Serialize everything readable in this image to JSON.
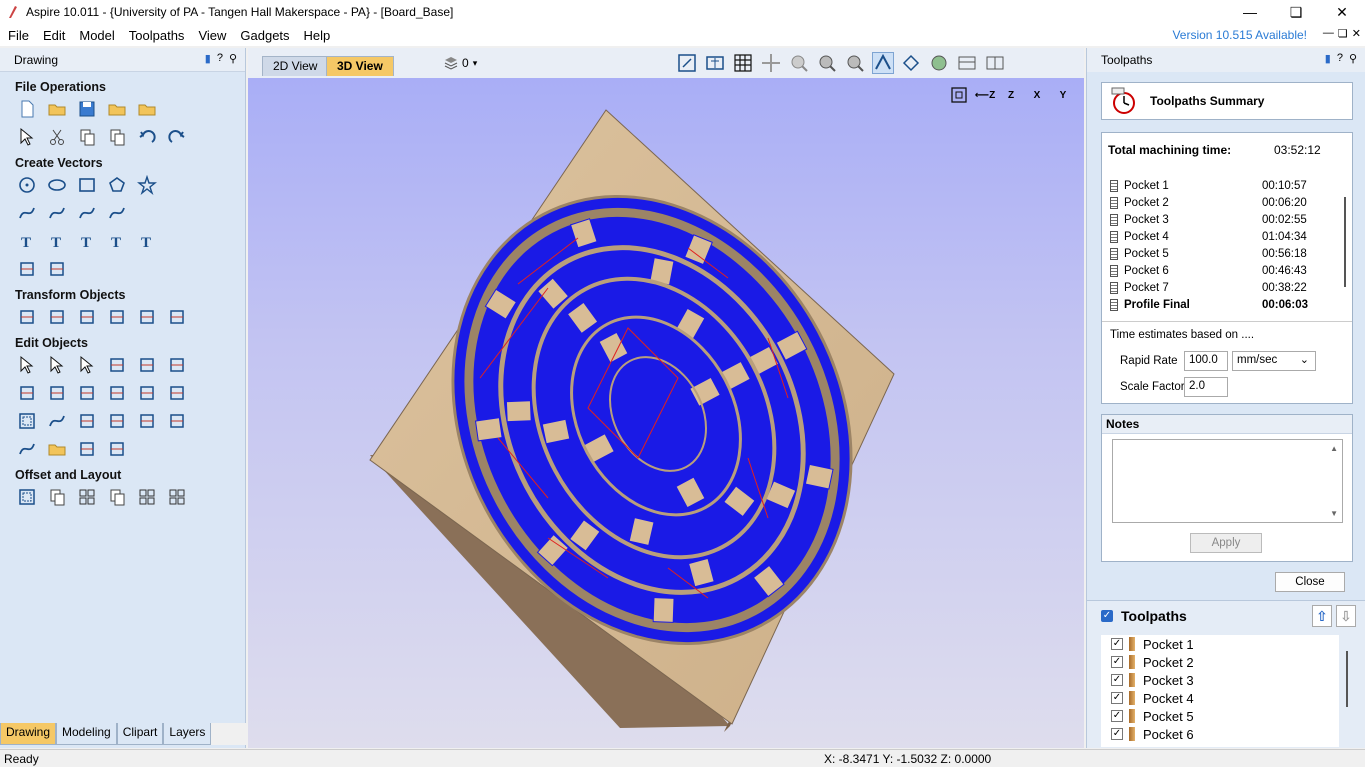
{
  "window": {
    "title": "Aspire 10.011 - {University of PA - Tangen Hall Makerspace - PA} - [Board_Base]"
  },
  "menu": {
    "items": [
      "File",
      "Edit",
      "Model",
      "Toolpaths",
      "View",
      "Gadgets",
      "Help"
    ],
    "version_notice": "Version 10.515 Available!"
  },
  "left_panel": {
    "header": "Drawing",
    "sections": [
      {
        "title": "File Operations",
        "icons": [
          [
            "new-file-icon",
            "open-file-icon",
            "save-icon",
            "import-icon",
            "export-icon"
          ],
          [
            "select-all-icon",
            "cut-icon",
            "copy-icon",
            "paste-icon",
            "undo-icon",
            "redo-icon"
          ]
        ]
      },
      {
        "title": "Create Vectors",
        "icons": [
          [
            "circle-icon",
            "ellipse-icon",
            "rectangle-icon",
            "polygon-icon",
            "star-icon"
          ],
          [
            "polyline-icon",
            "arc-icon",
            "curve-icon",
            "spiral-icon"
          ],
          [
            "text-icon",
            "text-box-icon",
            "text-on-curve-icon",
            "auto-layout-text-icon",
            "bend-text-icon"
          ],
          [
            "dimension-icon",
            "measure-icon"
          ]
        ]
      },
      {
        "title": "Transform Objects",
        "icons": [
          [
            "move-icon",
            "scale-icon",
            "align-icon",
            "mirror-icon",
            "distort-icon",
            "center-icon"
          ]
        ]
      },
      {
        "title": "Edit Objects",
        "icons": [
          [
            "node-select-icon",
            "node-add-icon",
            "node-edit-icon",
            "group-icon",
            "ungroup-icon",
            "trim-icon"
          ],
          [
            "weld-icon",
            "subtract-icon",
            "intersect-icon",
            "fillet-icon",
            "join-icon",
            "smooth-icon"
          ],
          [
            "offset-icon",
            "fit-curve-icon",
            "extend-icon",
            "close-vector-icon",
            "edit-sheet-icon",
            "image-icon"
          ],
          [
            "curve-join-icon",
            "open-end-icon",
            "end-bend-icon",
            "split-end-icon"
          ]
        ]
      },
      {
        "title": "Offset and Layout",
        "icons": [
          [
            "offset-vector-icon",
            "array-copy-icon",
            "circular-array-icon",
            "copy-along-vector-icon",
            "nest-parts-icon",
            "tiling-icon"
          ]
        ]
      }
    ],
    "tabs": [
      "Drawing",
      "Modeling",
      "Clipart",
      "Layers"
    ],
    "active_tab": "Drawing"
  },
  "view_tabs": {
    "tabs": [
      "2D View",
      "3D View"
    ],
    "active": "3D View",
    "layer_value": "0"
  },
  "right_panel": {
    "header": "Toolpaths",
    "summary_title": "Toolpaths Summary",
    "total_label": "Total machining time:",
    "total_value": "03:52:12",
    "rows": [
      {
        "name": "Pocket 1",
        "time": "00:10:57"
      },
      {
        "name": "Pocket 2",
        "time": "00:06:20"
      },
      {
        "name": "Pocket 3",
        "time": "00:02:55"
      },
      {
        "name": "Pocket 4",
        "time": "01:04:34"
      },
      {
        "name": "Pocket 5",
        "time": "00:56:18"
      },
      {
        "name": "Pocket 6",
        "time": "00:46:43"
      },
      {
        "name": "Pocket 7",
        "time": "00:38:22"
      },
      {
        "name": "Profile Final",
        "time": "00:06:03"
      }
    ],
    "based_on": "Time estimates based on ....",
    "rapid_rate_label": "Rapid Rate",
    "rapid_rate_value": "100.0",
    "rapid_rate_unit": "mm/sec",
    "scale_factor_label": "Scale Factor",
    "scale_factor_value": "2.0",
    "notes_title": "Notes",
    "apply_label": "Apply",
    "close_label": "Close",
    "toolpath_list_title": "Toolpaths",
    "toolpath_list": [
      "Pocket 1",
      "Pocket 2",
      "Pocket 3",
      "Pocket 4",
      "Pocket 5",
      "Pocket 6"
    ]
  },
  "status": {
    "text": "Ready",
    "coords": "X: -8.3471 Y: -1.5032 Z:  0.0000"
  },
  "colors": {
    "accent_tab": "#f5c866",
    "panel_bg": "#dbe7f5",
    "version_link": "#2a7bd5",
    "toolpath_blue": "#1a1ae6",
    "wood": "#d8bc96"
  }
}
